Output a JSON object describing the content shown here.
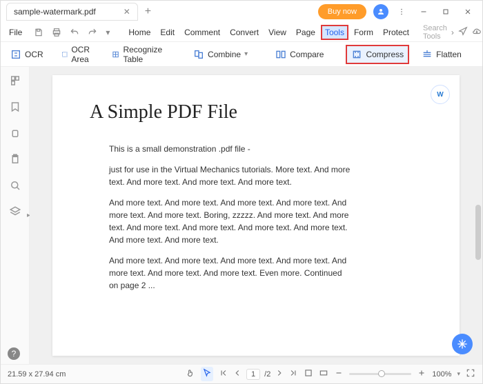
{
  "titlebar": {
    "tab_title": "sample-watermark.pdf",
    "buy_label": "Buy now"
  },
  "menubar": {
    "file": "File",
    "items": [
      "Home",
      "Edit",
      "Comment",
      "Convert",
      "View",
      "Page",
      "Tools",
      "Form",
      "Protect"
    ],
    "highlighted_index": 6,
    "search_placeholder": "Search Tools"
  },
  "toolbar": {
    "ocr": "OCR",
    "ocr_area": "OCR Area",
    "recognize_table": "Recognize Table",
    "combine": "Combine",
    "compare": "Compare",
    "compress": "Compress",
    "flatten": "Flatten"
  },
  "document": {
    "title": "A Simple PDF File",
    "paragraphs": [
      "This is a small demonstration .pdf file -",
      "just for use in the Virtual Mechanics tutorials. More text. And more text. And more text. And more text. And more text.",
      "And more text. And more text. And more text. And more text. And more text. And more text. Boring, zzzzz. And more text. And more text. And more text. And more text. And more text. And more text. And more text. And more text.",
      "And more text. And more text. And more text. And more text. And more text. And more text. And more text. Even more. Continued on page 2 ..."
    ],
    "word_badge": "W"
  },
  "statusbar": {
    "dimensions": "21.59 x 27.94 cm",
    "page_current": "1",
    "page_total": "/2",
    "zoom": "100%"
  }
}
